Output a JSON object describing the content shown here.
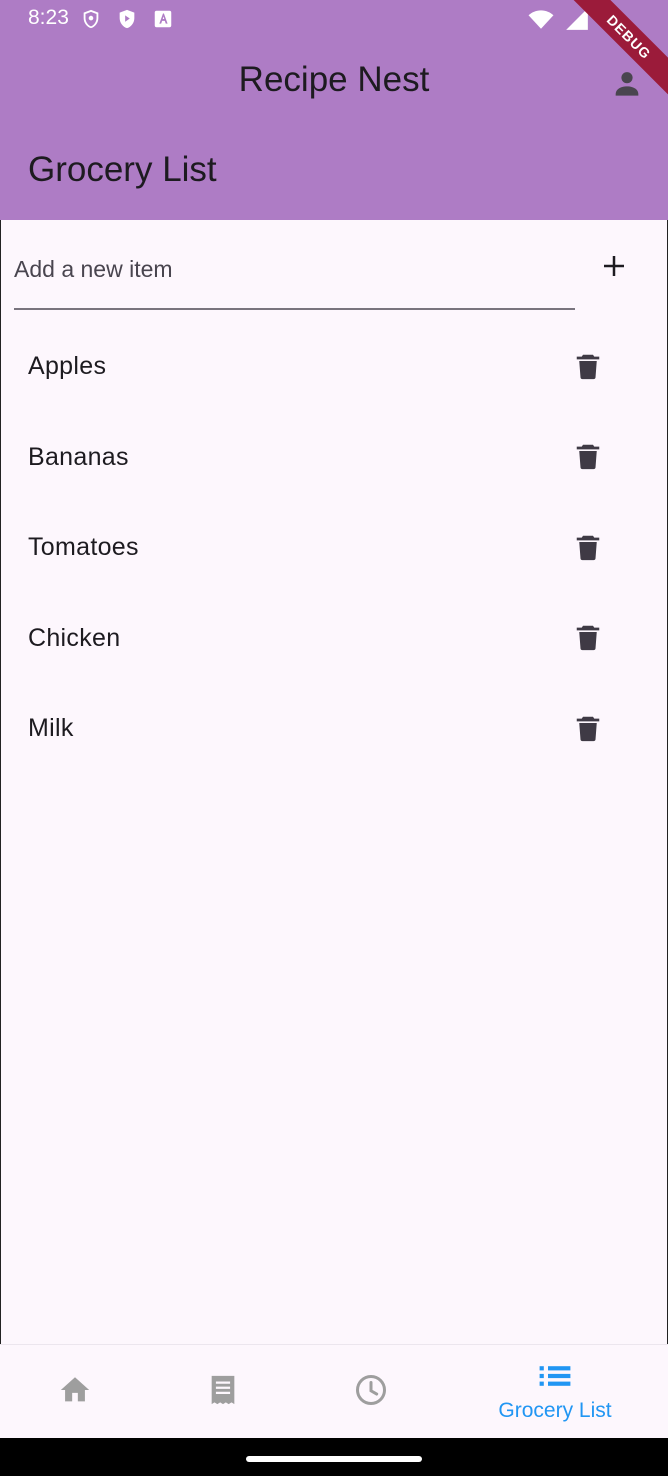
{
  "status_bar": {
    "time": "8:23"
  },
  "debug_banner": "DEBUG",
  "app_bar": {
    "title": "Recipe Nest",
    "page_title": "Grocery List",
    "profile_icon": "person-icon",
    "background_color": "#ae7cc5"
  },
  "add_item": {
    "placeholder": "Add a new item",
    "value": "",
    "add_icon": "plus-icon"
  },
  "grocery_items": [
    {
      "label": "Apples"
    },
    {
      "label": "Bananas"
    },
    {
      "label": "Tomatoes"
    },
    {
      "label": "Chicken"
    },
    {
      "label": "Milk"
    }
  ],
  "bottom_nav": {
    "items": [
      {
        "icon": "home-icon",
        "label": "",
        "selected": false
      },
      {
        "icon": "receipt-icon",
        "label": "",
        "selected": false
      },
      {
        "icon": "clock-icon",
        "label": "",
        "selected": false
      },
      {
        "icon": "list-icon",
        "label": "Grocery List",
        "selected": true
      }
    ],
    "selected_color": "#2196f3",
    "unselected_color": "#9e9e9e"
  }
}
